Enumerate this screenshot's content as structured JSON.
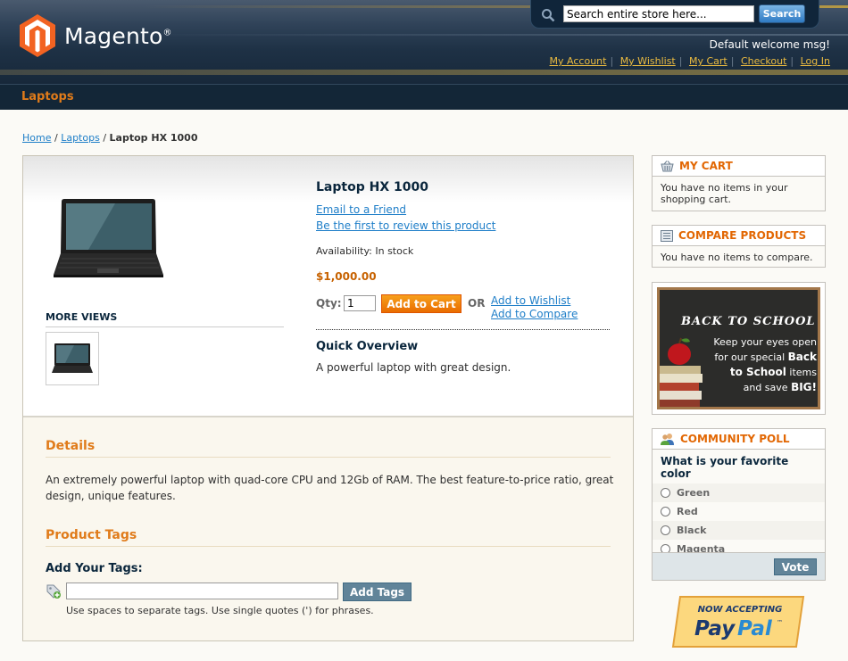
{
  "header": {
    "logo_text": "Magento",
    "logo_reg": "®",
    "search_placeholder": "Search entire store here...",
    "search_button": "Search",
    "welcome": "Default welcome msg!",
    "links": [
      "My Account",
      "My Wishlist",
      "My Cart",
      "Checkout",
      "Log In"
    ]
  },
  "nav": {
    "item": "Laptops"
  },
  "breadcrumb": {
    "home": "Home",
    "category": "Laptops",
    "current": "Laptop HX 1000",
    "sep": "/"
  },
  "product": {
    "name": "Laptop HX 1000",
    "email_link": "Email to a Friend",
    "review_link": "Be the first to review this product",
    "availability": "Availability: In stock",
    "price": "$1,000.00",
    "qty_label": "Qty:",
    "qty_value": "1",
    "add_to_cart": "Add to Cart",
    "or": "OR",
    "wishlist_link": "Add to Wishlist",
    "compare_link": "Add to Compare",
    "more_views": "MORE VIEWS",
    "overview_title": "Quick Overview",
    "overview_text": "A powerful laptop with great design.",
    "details_title": "Details",
    "details_text": "An extremely powerful laptop with quad-core CPU and 12Gb of RAM. The best feature-to-price ratio, great design, unique features.",
    "tags_title": "Product Tags",
    "add_tags_label": "Add Your Tags:",
    "add_tags_button": "Add Tags",
    "tags_hint": "Use spaces to separate tags. Use single quotes (') for phrases."
  },
  "sidebar": {
    "cart": {
      "title": "MY CART",
      "text": "You have no items in your shopping cart."
    },
    "compare": {
      "title": "COMPARE PRODUCTS",
      "text": "You have no items to compare."
    },
    "promo": {
      "title": "BACK TO SCHOOL",
      "line1": "Keep your eyes open",
      "line2": "for our special",
      "bold1": "Back",
      "line3": "to School",
      "line3b": "items",
      "line4": "and save",
      "bold2": "BIG!"
    },
    "poll": {
      "title": "COMMUNITY POLL",
      "question": "What is your favorite color",
      "options": [
        "Green",
        "Red",
        "Black",
        "Magenta"
      ],
      "vote": "Vote"
    },
    "paypal": {
      "top": "NOW ACCEPTING",
      "pay": "Pay",
      "pal": "Pal",
      "tm": "™"
    }
  },
  "colors": {
    "accent_orange": "#e26703",
    "link_blue": "#1e7ec8",
    "header_dark": "#17283a"
  }
}
